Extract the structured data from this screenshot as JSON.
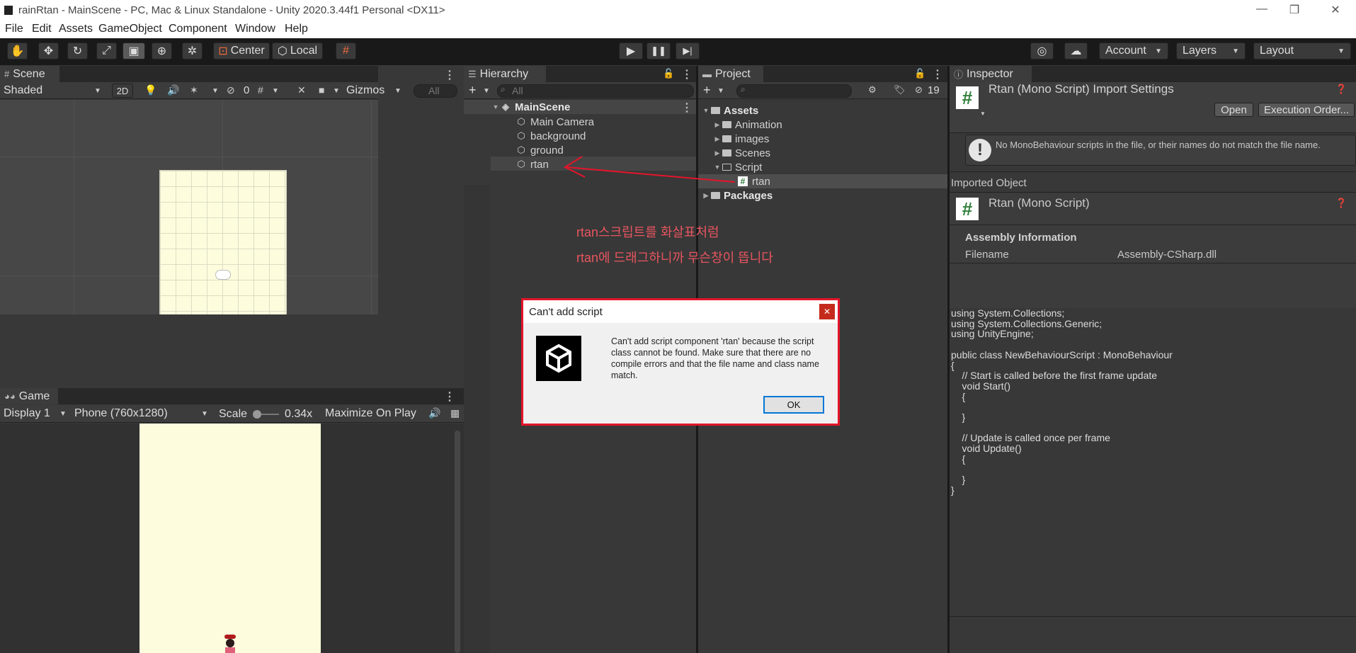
{
  "window": {
    "title": "rainRtan - MainScene - PC, Mac & Linux Standalone - Unity 2020.3.44f1 Personal <DX11>",
    "minimize_glyph": "—",
    "maximize_glyph": "❐",
    "close_glyph": "✕"
  },
  "menu": [
    "File",
    "Edit",
    "Assets",
    "GameObject",
    "Component",
    "Window",
    "Help"
  ],
  "toolbar": {
    "tools": [
      "hand-tool-icon",
      "move-tool-icon",
      "rotate-tool-icon",
      "scale-tool-icon",
      "rect-tool-icon",
      "transform-tool-icon",
      "custom-tool-icon"
    ],
    "pivot_mode": "Center",
    "pivot_rotation": "Local",
    "play_glyph": "▶",
    "pause_glyph": "❚❚",
    "step_glyph": "▶|",
    "account": "Account",
    "layers": "Layers",
    "layout": "Layout"
  },
  "scene": {
    "tab": "Scene",
    "shading": "Shaded",
    "mode_2d": "2D",
    "hidden_count": "0",
    "gizmos": "Gizmos",
    "search_placeholder": "All"
  },
  "game": {
    "tab": "Game",
    "display": "Display 1",
    "resolution": "Phone (760x1280)",
    "scale_label": "Scale",
    "scale_value": "0.34x",
    "maximize": "Maximize On Play"
  },
  "hierarchy": {
    "tab": "Hierarchy",
    "search_placeholder": "All",
    "scene_name": "MainScene",
    "objects": [
      "Main Camera",
      "background",
      "ground",
      "rtan"
    ]
  },
  "project": {
    "tab": "Project",
    "hidden_count": "19",
    "root": "Assets",
    "folders": [
      "Animation",
      "images",
      "Scenes",
      "Script"
    ],
    "script_file": "rtan",
    "packages": "Packages"
  },
  "annotation": {
    "line1": "rtan스크립트를 화살표처럼",
    "line2": "rtan에 드래그하니까 무슨창이 뜹니다",
    "color": "#e8555f"
  },
  "inspector": {
    "tab": "Inspector",
    "header_title": "Rtan (Mono Script) Import Settings",
    "open_button": "Open",
    "exec_order_button": "Execution Order...",
    "warning": "No MonoBehaviour scripts in the file, or their names do not match the file name.",
    "imported_object_label": "Imported Object",
    "object_name": "Rtan (Mono Script)",
    "assembly_heading": "Assembly Information",
    "filename_label": "Filename",
    "filename_value": "Assembly-CSharp.dll",
    "code_lines": [
      "using System.Collections;",
      "using System.Collections.Generic;",
      "using UnityEngine;",
      "",
      "public class NewBehaviourScript : MonoBehaviour",
      "{",
      "    // Start is called before the first frame update",
      "    void Start()",
      "    {",
      "",
      "    }",
      "",
      "    // Update is called once per frame",
      "    void Update()",
      "    {",
      "",
      "    }",
      "}"
    ]
  },
  "dialog": {
    "title": "Can't add script",
    "close_glyph": "✕",
    "message": "Can't add script component 'rtan' because the script class cannot be found. Make sure that there are no compile errors and that the file name and class name match.",
    "ok": "OK"
  }
}
